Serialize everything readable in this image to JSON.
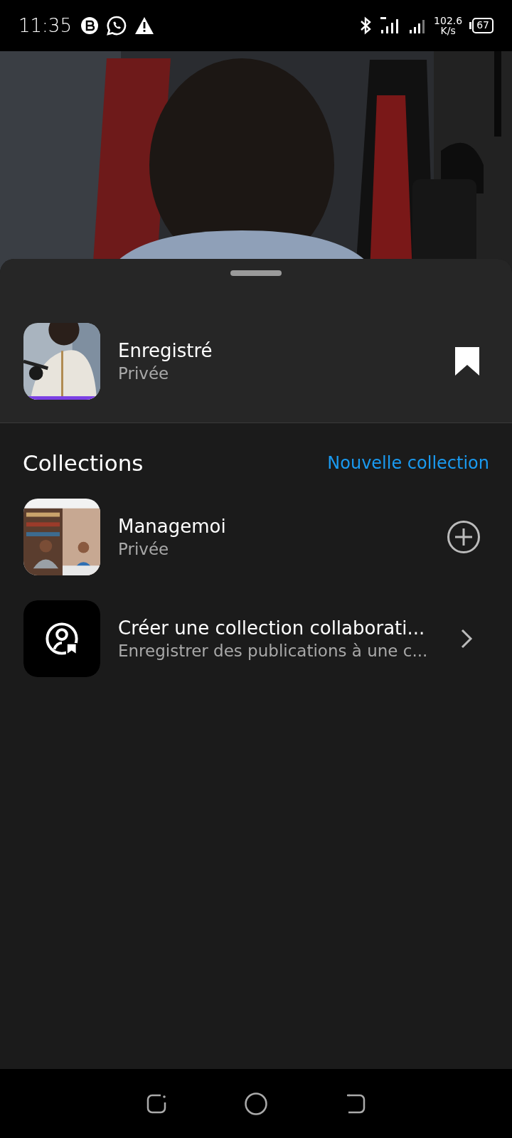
{
  "status_bar": {
    "time": "11:35",
    "speed_value": "102.6",
    "speed_unit": "K/s",
    "battery": "67"
  },
  "saved": {
    "title": "Enregistré",
    "subtitle": "Privée",
    "bookmarked": true
  },
  "collections": {
    "title": "Collections",
    "action": "Nouvelle collection",
    "items": [
      {
        "kind": "collection",
        "title": "Managemoi",
        "subtitle": "Privée"
      },
      {
        "kind": "collaborative",
        "title": "Créer une collection collaborati...",
        "subtitle": "Enregistrer des publications à une c..."
      }
    ]
  }
}
